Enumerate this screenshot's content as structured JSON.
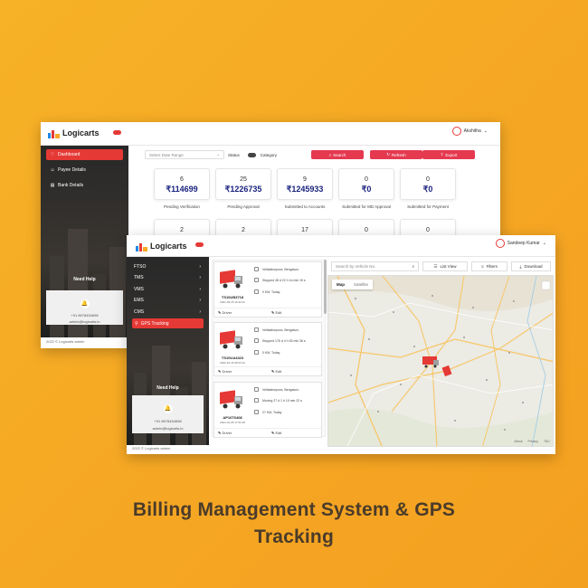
{
  "caption": {
    "line1": "Billing Management System & GPS",
    "line2": "Tracking"
  },
  "colors": {
    "background": "#f5a623",
    "accent": "#e53935",
    "amount": "#1a237e"
  },
  "billing": {
    "brand": "Logicarts",
    "user_name": "Akshitha",
    "sidebar": [
      {
        "label": "Dashboard",
        "icon": "heart-icon",
        "active": true
      },
      {
        "label": "Payee Details",
        "icon": "users-icon",
        "active": false
      },
      {
        "label": "Bank Details",
        "icon": "bank-icon",
        "active": false
      }
    ],
    "help": {
      "title": "Need Help",
      "phone": "+91 8978454698",
      "email": "admin@logicarts.in"
    },
    "footer": "2022 © Logicarts admin",
    "filters": {
      "date_placeholder": "Select Date Range",
      "status_label": "Status",
      "category_label": "Category",
      "search_btn": "Search",
      "refresh_btn": "Refresh",
      "export_btn": "Export"
    },
    "cards": [
      {
        "count": "6",
        "amount": "₹114699",
        "label": "Pending Verification"
      },
      {
        "count": "25",
        "amount": "₹1226735",
        "label": "Pending Approval"
      },
      {
        "count": "9",
        "amount": "₹1245933",
        "label": "Submitted to Accounts"
      },
      {
        "count": "0",
        "amount": "₹0",
        "label": "Submitted for MD Approval"
      },
      {
        "count": "0",
        "amount": "₹0",
        "label": "Submitted for Payment"
      }
    ],
    "cards_row2": [
      "2",
      "2",
      "17",
      "0",
      "0"
    ]
  },
  "gps": {
    "brand": "Logicarts",
    "user_name": "Sandeep Kumar",
    "sidebar": [
      {
        "label": "FTSO",
        "active": false
      },
      {
        "label": "TMS",
        "active": false
      },
      {
        "label": "VMS",
        "active": false
      },
      {
        "label": "EMS",
        "active": false
      },
      {
        "label": "CMS",
        "active": false
      },
      {
        "label": "GPS Tracking",
        "active": true
      }
    ],
    "help": {
      "title": "Need Help",
      "phone": "+91 8978454698",
      "email": "admin@logicarts.in"
    },
    "footer": "2022 © Logicarts admin",
    "search_placeholder": "Search by Vehicle No.",
    "list_view": "List View",
    "filters": "Filters",
    "download": "Download",
    "map_tabs": [
      "Map",
      "Satellite"
    ],
    "map_footer": [
      "About",
      "Privacy",
      "T&C"
    ],
    "vehicles": [
      {
        "number": "TS10UB3718",
        "date": "2021-03-25 16:32:11",
        "location": "Vellalaborpura, Bengaluru",
        "status": "Stopped 48 d 22 h 1d min 15 s",
        "speed": "0 KM, Today",
        "driver": "Driver",
        "edit": "Edit"
      },
      {
        "number": "TS10UA4323",
        "date": "2020-10-16 08:33:12",
        "location": "Vellalaborpura, Bengaluru",
        "status": "Stopped 176 d 4 h 53 min 36 s",
        "speed": "0 KM, Today",
        "driver": "Driver",
        "edit": "Edit"
      },
      {
        "number": "AP16T6408",
        "date": "2021-01-05 17:53:18",
        "location": "Vellalaborpura, Bengaluru",
        "status": "Moving 27 d 1 h 19 min 22 s",
        "speed": "27 KM, Today",
        "driver": "Driver",
        "edit": "Edit"
      }
    ]
  }
}
